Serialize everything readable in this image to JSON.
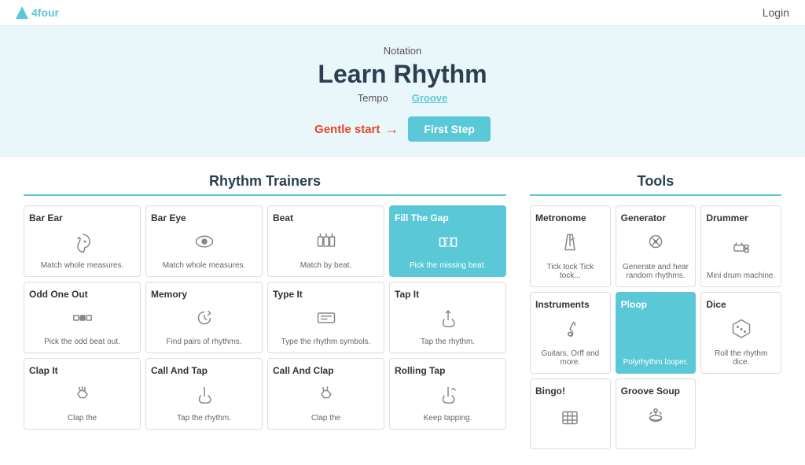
{
  "header": {
    "logo_text": "4four",
    "login_label": "Login"
  },
  "hero": {
    "notation_label": "Notation",
    "title": "Learn Rhythm",
    "tempo_label": "Tempo",
    "groove_label": "Groove",
    "gentle_start_label": "Gentle start",
    "first_step_label": "First Step"
  },
  "rhythm_trainers": {
    "section_title": "Rhythm Trainers",
    "cards": [
      {
        "id": "bar-ear",
        "title": "Bar Ear",
        "icon": "ear",
        "desc": "Match whole measures.",
        "active": false
      },
      {
        "id": "bar-eye",
        "title": "Bar Eye",
        "icon": "eye",
        "desc": "Match whole measures.",
        "active": false
      },
      {
        "id": "beat",
        "title": "Beat",
        "icon": "beat",
        "desc": "Match by beat.",
        "active": false
      },
      {
        "id": "fill-the-gap",
        "title": "Fill The Gap",
        "icon": "gap",
        "desc": "Pick the missing beat.",
        "active": true
      },
      {
        "id": "odd-one-out",
        "title": "Odd One Out",
        "icon": "odd",
        "desc": "Pick the odd beat out.",
        "active": false
      },
      {
        "id": "memory",
        "title": "Memory",
        "icon": "memory",
        "desc": "Find pairs of rhythms.",
        "active": false
      },
      {
        "id": "type-it",
        "title": "Type It",
        "icon": "type",
        "desc": "Type the rhythm symbols.",
        "active": false
      },
      {
        "id": "tap-it",
        "title": "Tap It",
        "icon": "tap",
        "desc": "Tap the rhythm.",
        "active": false
      },
      {
        "id": "clap-it",
        "title": "Clap It",
        "icon": "clap",
        "desc": "Clap the",
        "active": false
      },
      {
        "id": "call-and-tap",
        "title": "Call And Tap",
        "icon": "call-tap",
        "desc": "Tap the rhythm.",
        "active": false
      },
      {
        "id": "call-and-clap",
        "title": "Call And Clap",
        "icon": "call-clap",
        "desc": "Clap the",
        "active": false
      },
      {
        "id": "rolling-tap",
        "title": "Rolling Tap",
        "icon": "rolling",
        "desc": "Keep tapping.",
        "active": false
      }
    ]
  },
  "tools": {
    "section_title": "Tools",
    "cards": [
      {
        "id": "metronome",
        "title": "Metronome",
        "icon": "metronome",
        "desc": "Tick tock Tick tock...",
        "active": false
      },
      {
        "id": "generator",
        "title": "Generator",
        "icon": "generator",
        "desc": "Generate and hear random rhythms.",
        "active": false
      },
      {
        "id": "drummer",
        "title": "Drummer",
        "icon": "drummer",
        "desc": "Mini drum machine.",
        "active": false
      },
      {
        "id": "instruments",
        "title": "Instruments",
        "icon": "instruments",
        "desc": "Guitars, Orff and more.",
        "active": false
      },
      {
        "id": "ploop",
        "title": "Ploop",
        "icon": "ploop",
        "desc": "Polyrhythm looper.",
        "active": true
      },
      {
        "id": "dice",
        "title": "Dice",
        "icon": "dice",
        "desc": "Roll the rhythm dice.",
        "active": false
      },
      {
        "id": "bingo",
        "title": "Bingo!",
        "icon": "bingo",
        "desc": "",
        "active": false
      },
      {
        "id": "groove-soup",
        "title": "Groove Soup",
        "icon": "groove-soup",
        "desc": "",
        "active": false
      }
    ]
  }
}
